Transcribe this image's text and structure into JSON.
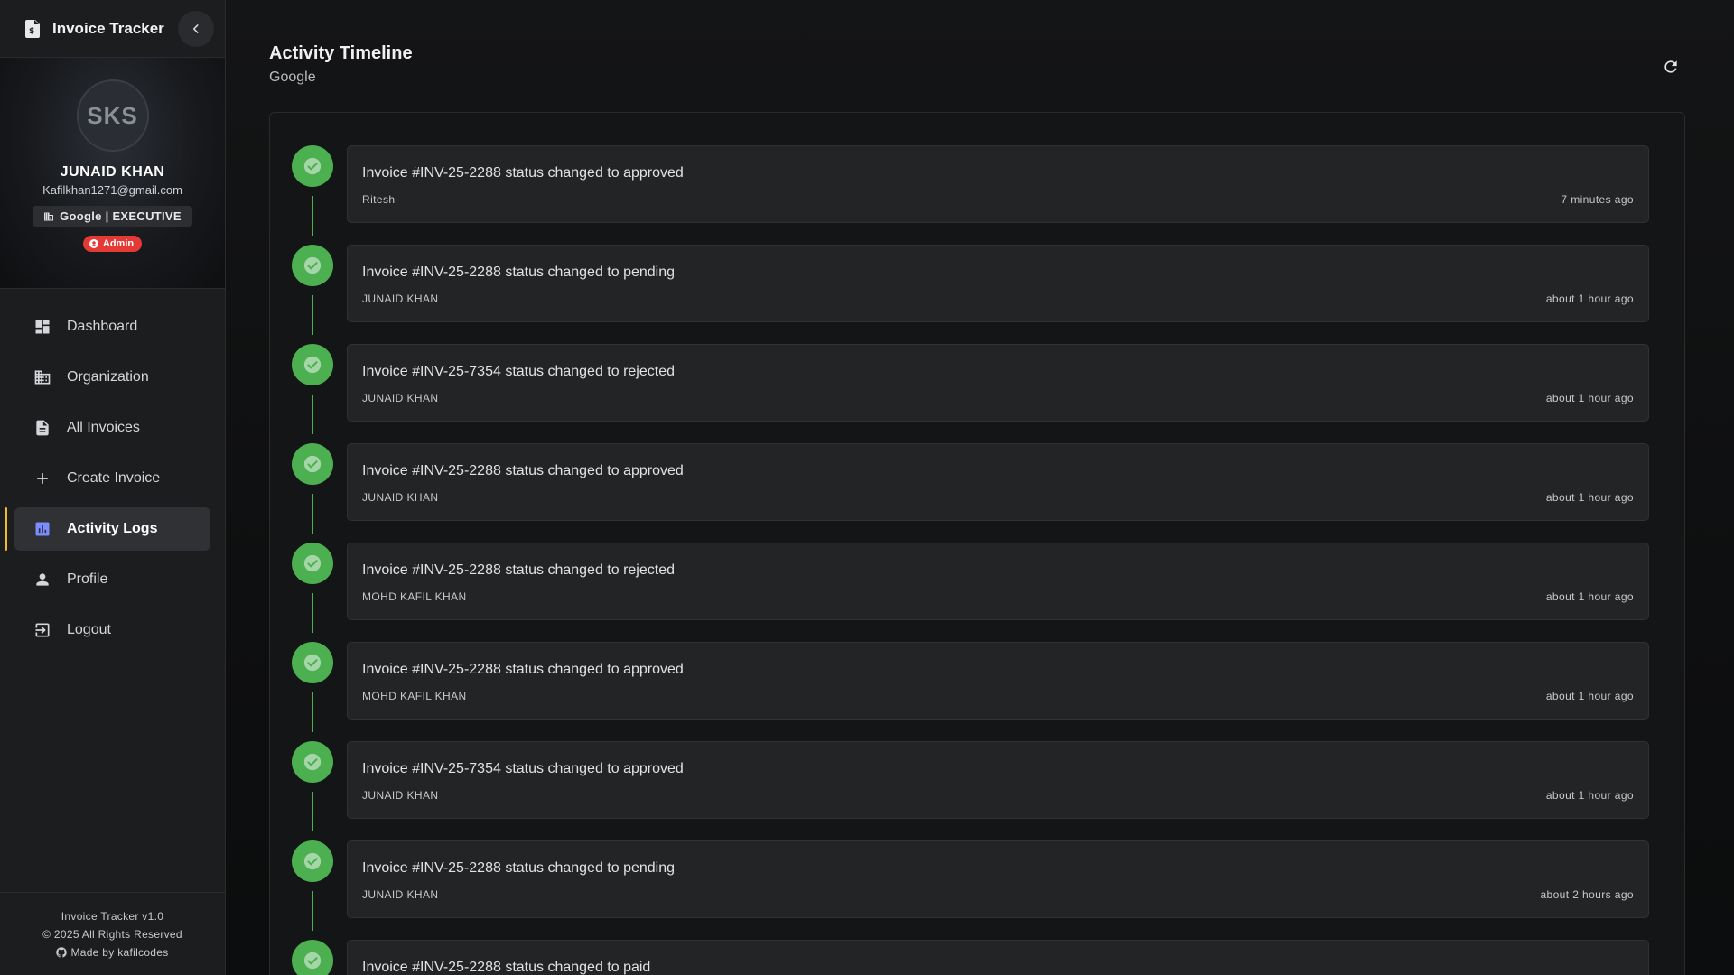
{
  "app": {
    "title": "Invoice Tracker"
  },
  "user": {
    "initials": "SKS",
    "name": "JUNAID KHAN",
    "email": "Kafilkhan1271@gmail.com",
    "org_role": "Google | EXECUTIVE",
    "badge": "Admin"
  },
  "nav": {
    "items": [
      {
        "label": "Dashboard",
        "icon": "dashboard-icon"
      },
      {
        "label": "Organization",
        "icon": "organization-icon"
      },
      {
        "label": "All Invoices",
        "icon": "document-icon"
      },
      {
        "label": "Create Invoice",
        "icon": "plus-icon"
      },
      {
        "label": "Activity Logs",
        "icon": "bar-chart-icon",
        "active": true
      },
      {
        "label": "Profile",
        "icon": "person-icon"
      },
      {
        "label": "Logout",
        "icon": "logout-icon"
      }
    ]
  },
  "footer": {
    "version": "Invoice Tracker v1.0",
    "copyright": "© 2025 All Rights Reserved",
    "made_by": "Made by kafilcodes"
  },
  "page": {
    "title": "Activity Timeline",
    "subtitle": "Google"
  },
  "timeline": [
    {
      "message": "Invoice #INV-25-2288 status changed to approved",
      "user": "Ritesh",
      "time": "7 minutes ago"
    },
    {
      "message": "Invoice #INV-25-2288 status changed to pending",
      "user": "JUNAID KHAN",
      "time": "about 1 hour ago"
    },
    {
      "message": "Invoice #INV-25-7354 status changed to rejected",
      "user": "JUNAID KHAN",
      "time": "about 1 hour ago"
    },
    {
      "message": "Invoice #INV-25-2288 status changed to approved",
      "user": "JUNAID KHAN",
      "time": "about 1 hour ago"
    },
    {
      "message": "Invoice #INV-25-2288 status changed to rejected",
      "user": "MOHD KAFIL KHAN",
      "time": "about 1 hour ago"
    },
    {
      "message": "Invoice #INV-25-2288 status changed to approved",
      "user": "MOHD KAFIL KHAN",
      "time": "about 1 hour ago"
    },
    {
      "message": "Invoice #INV-25-7354 status changed to approved",
      "user": "JUNAID KHAN",
      "time": "about 1 hour ago"
    },
    {
      "message": "Invoice #INV-25-2288 status changed to pending",
      "user": "JUNAID KHAN",
      "time": "about 2 hours ago"
    },
    {
      "message": "Invoice #INV-25-2288 status changed to paid",
      "user": "",
      "time": ""
    }
  ],
  "colors": {
    "accent_active": "#f5b82e",
    "success": "#4caf50",
    "admin_badge": "#e53935"
  }
}
